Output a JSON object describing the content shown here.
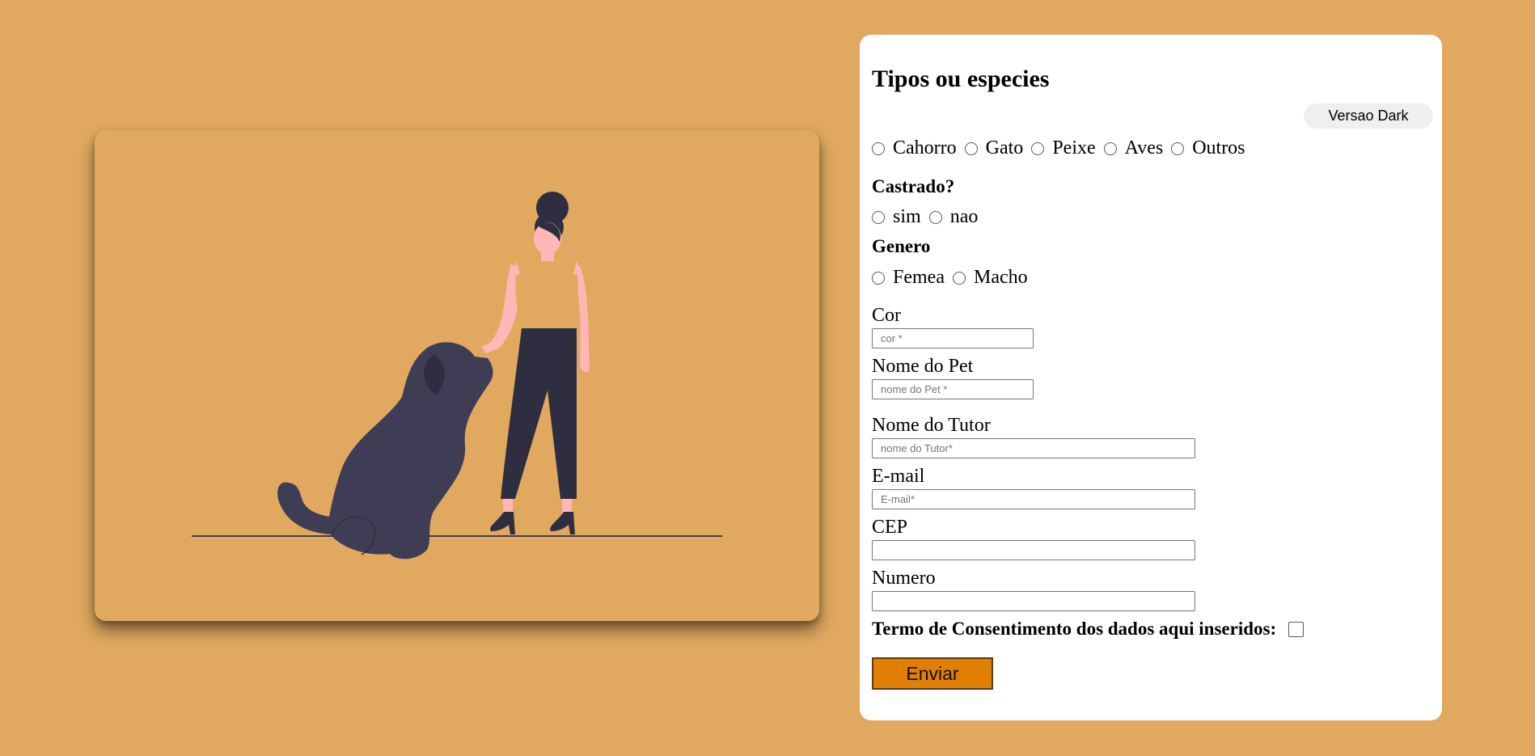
{
  "form": {
    "title": "Tipos ou especies",
    "theme_button": "Versao Dark",
    "species": [
      "Cahorro",
      "Gato",
      "Peixe",
      "Aves",
      "Outros"
    ],
    "castrado": {
      "label": "Castrado?",
      "options": [
        "sim",
        "nao"
      ]
    },
    "genero": {
      "label": "Genero",
      "options": [
        "Femea",
        "Macho"
      ]
    },
    "fields": {
      "cor": {
        "label": "Cor",
        "placeholder": "cor *"
      },
      "nome_pet": {
        "label": "Nome do Pet",
        "placeholder": "nome do Pet *"
      },
      "nome_tutor": {
        "label": "Nome do Tutor",
        "placeholder": "nome do Tutor*"
      },
      "email": {
        "label": "E-mail",
        "placeholder": "E-mail*"
      },
      "cep": {
        "label": "CEP",
        "placeholder": ""
      },
      "numero": {
        "label": "Numero",
        "placeholder": ""
      }
    },
    "consent_label": "Termo de Consentimento dos dados aqui inseridos:",
    "submit_label": "Enviar"
  },
  "colors": {
    "background": "#e0a95f",
    "card": "#ffffff",
    "submit": "#e07f04",
    "dog": "#3f3d56",
    "pants": "#2f2e41",
    "skin": "#ffb6b6"
  },
  "illustration": {
    "icon": "woman-petting-dog-illustration"
  }
}
